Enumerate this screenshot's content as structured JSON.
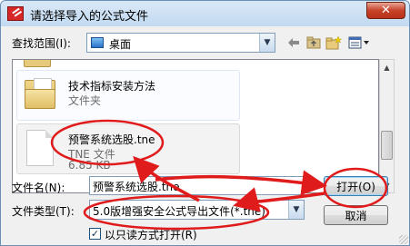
{
  "window": {
    "title": "请选择导入的公式文件",
    "close_label": "✕",
    "icons": {
      "app": "formula-app-icon",
      "close": "close-icon"
    }
  },
  "lookin": {
    "label": "查找范围(I):",
    "value": "桌面",
    "icon": "desktop-icon"
  },
  "toolbar": {
    "icons": [
      "back-arrow-icon",
      "up-folder-icon",
      "new-folder-icon",
      "view-menu-icon"
    ]
  },
  "files": [
    {
      "name": "技术指标安装方法",
      "type": "文件夹",
      "size": "",
      "icon": "folder-icon"
    },
    {
      "name": "预警系统选股.tne",
      "type": "TNE 文件",
      "size": "6.85 KB",
      "icon": "document-icon"
    }
  ],
  "form": {
    "filename_label": "文件名(N):",
    "filename_value": "预警系统选股.tne",
    "filetype_label": "文件类型(T):",
    "filetype_value": "5.0版增强安全公式导出文件(*.tne)",
    "readonly_label": "以只读方式打开(R)",
    "readonly_checked": true
  },
  "buttons": {
    "open": "打开(O)",
    "cancel": "取消"
  },
  "colors": {
    "annotation": "#e01b1b",
    "title_bg": "#c6dcf2",
    "close_btn": "#c7432a"
  }
}
